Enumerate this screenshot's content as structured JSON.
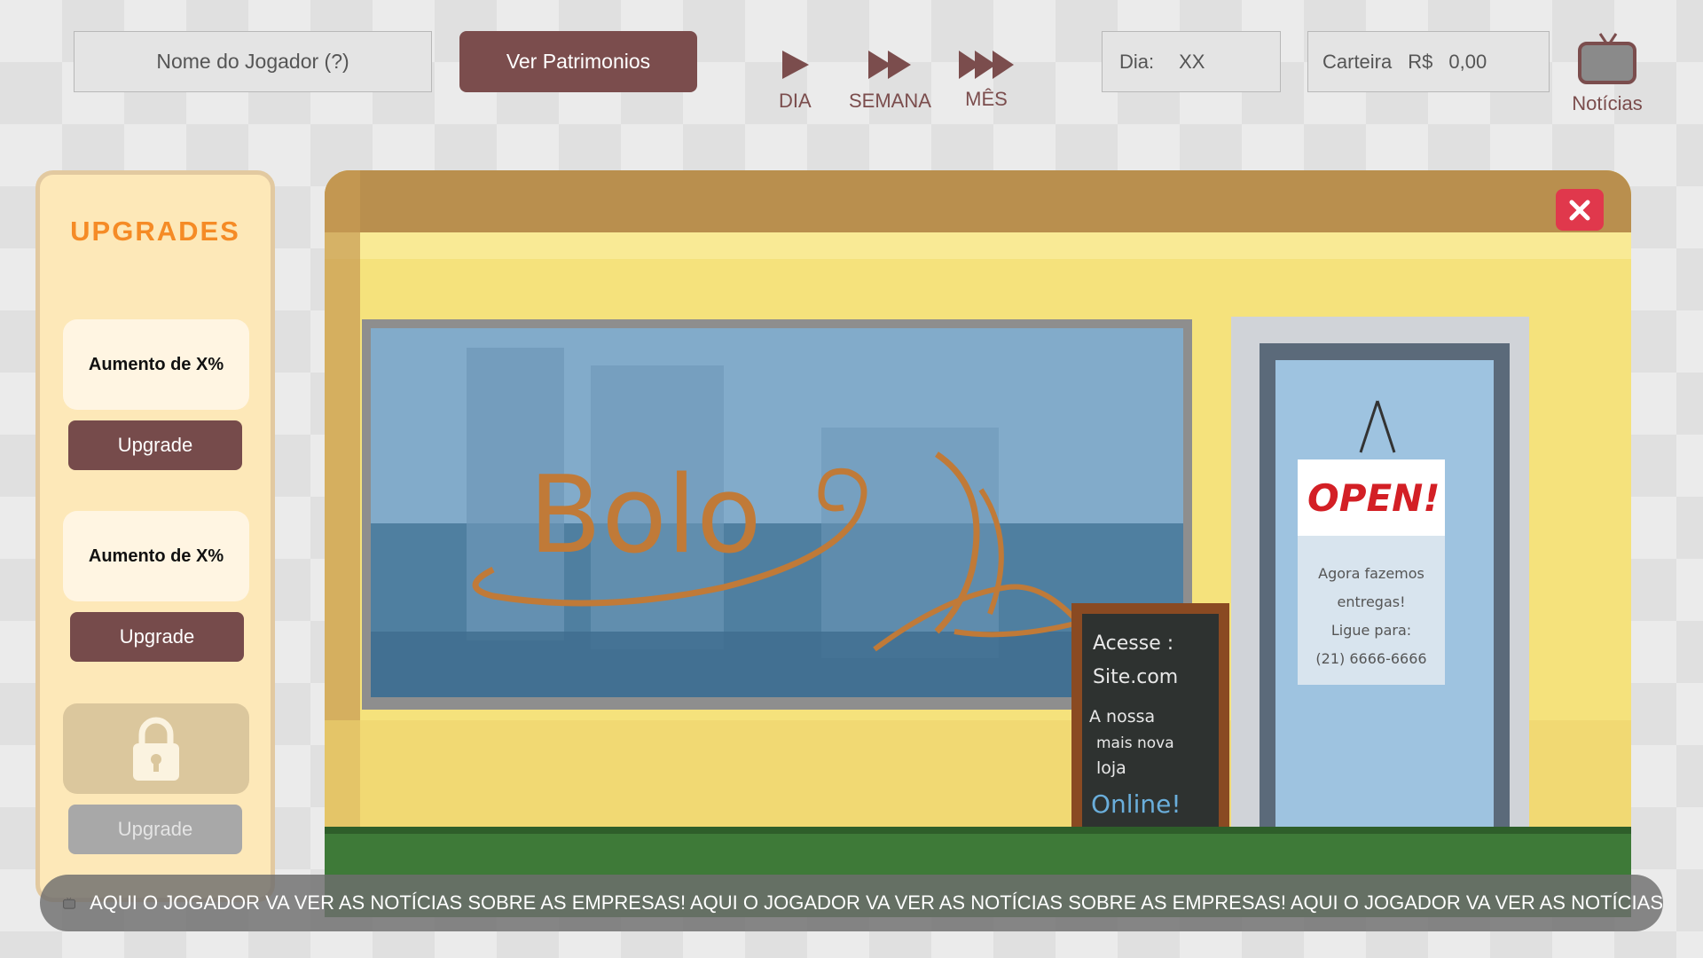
{
  "topbar": {
    "player_name": "Nome do Jogador (?)",
    "assets_button": "Ver Patrimonios",
    "speed_controls": [
      {
        "label": "DIA",
        "icon": "play-icon"
      },
      {
        "label": "SEMANA",
        "icon": "fast-forward-icon"
      },
      {
        "label": "MÊS",
        "icon": "triple-forward-icon"
      }
    ],
    "day_label": "Dia:",
    "day_value": "XX",
    "wallet_label": "Carteira",
    "wallet_currency": "R$",
    "wallet_value": "0,00",
    "news_label": "Notícias",
    "news_icon": "tv-icon"
  },
  "upgrades": {
    "title": "UPGRADES",
    "items": [
      {
        "description": "Aumento de X%",
        "button": "Upgrade",
        "locked": false
      },
      {
        "description": "Aumento de X%",
        "button": "Upgrade",
        "locked": false
      },
      {
        "description": "",
        "button": "Upgrade",
        "locked": true,
        "icon": "lock-icon"
      }
    ]
  },
  "scene": {
    "shop_name": "Bolo",
    "door_sign": "OPEN!",
    "door_notice": [
      "Agora fazemos",
      "entregas!",
      "Ligue para:",
      "(21) 6666-6666"
    ],
    "chalkboard": [
      "Acesse :",
      "Site.com",
      "A nossa",
      "mais nova",
      "loja",
      "Online!"
    ],
    "close_icon": "close-icon"
  },
  "ticker": {
    "icon": "tv-icon",
    "text": "AQUI O JOGADOR VA VER AS NOTÍCIAS SOBRE AS EMPRESAS! AQUI O JOGADOR VA VER AS NOTÍCIAS SOBRE AS EMPRESAS! AQUI O JOGADOR VA VER AS NOTÍCIAS"
  },
  "colors": {
    "accent": "#7b4d4d",
    "upgrades_title": "#f58b26",
    "close": "#e0384c",
    "panel_bg": "#fde8b8"
  }
}
